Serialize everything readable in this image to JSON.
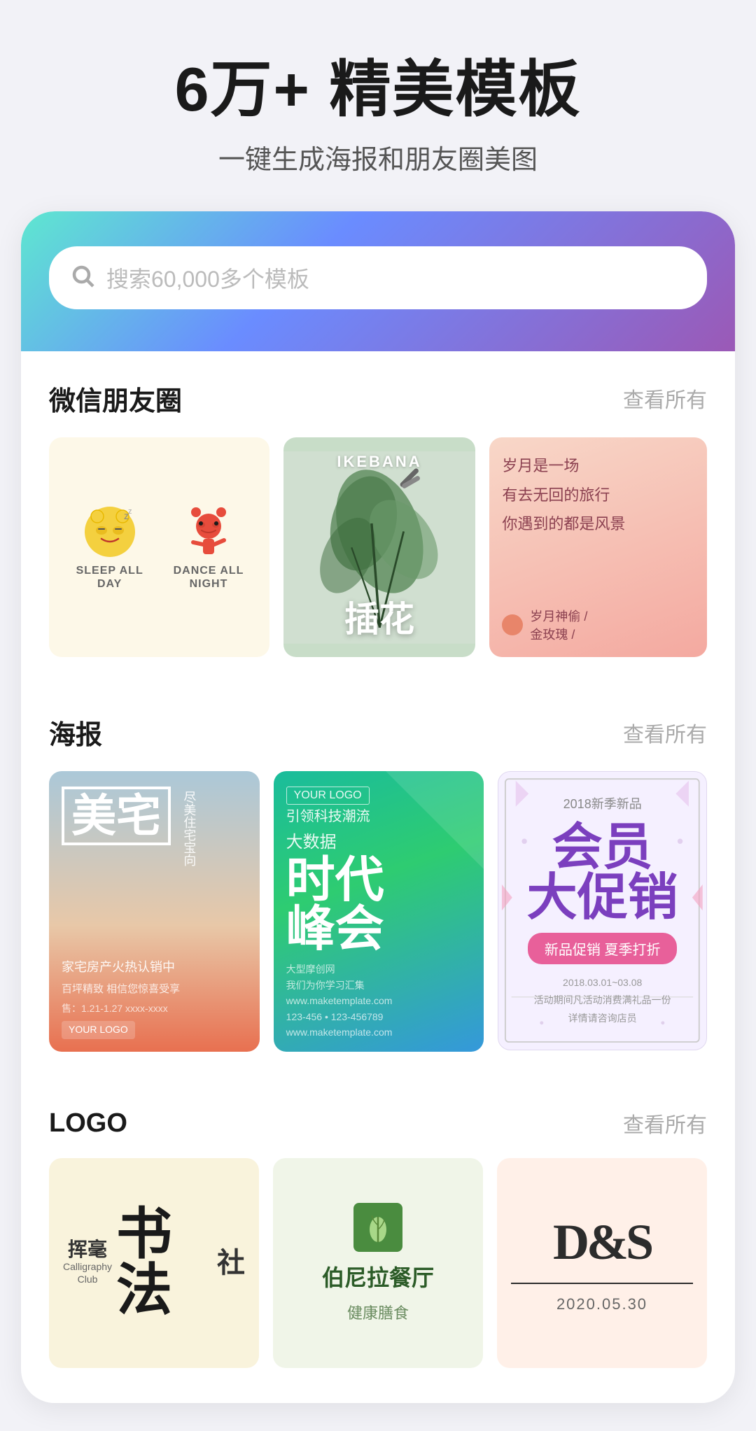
{
  "header": {
    "title": "6万+ 精美模板",
    "subtitle": "一键生成海报和朋友圈美图"
  },
  "search": {
    "placeholder": "搜索60,000多个模板"
  },
  "sections": [
    {
      "id": "wechat",
      "title": "微信朋友圈",
      "more_label": "查看所有",
      "templates": [
        {
          "id": "sleep-dance",
          "label_top": "SLEEP ALL DAY",
          "label_bottom": "DANCE ALL NIGHT"
        },
        {
          "id": "ikebana",
          "label_en": "IKEBANA",
          "label_cn": "插花"
        },
        {
          "id": "moments-poem",
          "line1": "岁月是一场",
          "line2": "有去无回的旅行",
          "line3": "你遇到的都是风景",
          "author": "岁月神偷 /",
          "author2": "金玫瑰 /"
        }
      ]
    },
    {
      "id": "poster",
      "title": "海报",
      "more_label": "查看所有",
      "templates": [
        {
          "id": "meizhai",
          "main": "美宅",
          "sub": "家宅房产火热认销中"
        },
        {
          "id": "bigdata",
          "logo": "YOUR LOGO",
          "title1": "时代",
          "title2": "峰会",
          "prefix": "大数据",
          "sub": "引领科技潮流"
        },
        {
          "id": "member",
          "year": "2018新季新品",
          "main1": "会员",
          "main2": "大促销",
          "sub": "新品促销 夏季打折"
        }
      ]
    },
    {
      "id": "logo",
      "title": "LOGO",
      "more_label": "查看所有",
      "templates": [
        {
          "id": "calligraphy",
          "cn_big": "书法",
          "cn_brush": "挥毫",
          "en_line1": "Calligraphy",
          "en_line2": "Club",
          "cn_small": "社"
        },
        {
          "id": "bernila",
          "name": "伯尼拉餐厅",
          "sub": "健康膳食"
        },
        {
          "id": "ds",
          "symbol": "D&S",
          "date": "2020.05.30"
        }
      ]
    }
  ]
}
